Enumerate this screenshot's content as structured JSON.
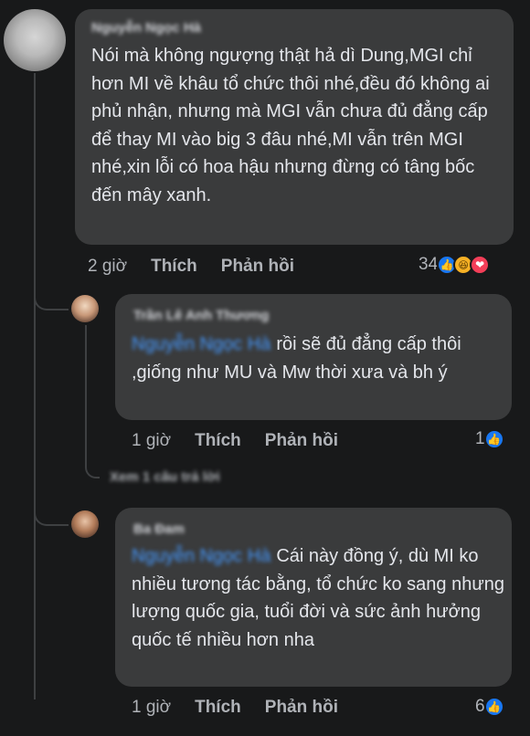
{
  "comment": {
    "author": "Nguyễn Ngọc Hà",
    "text": "Nói mà không ngượng thật hả dì Dung,MGI chỉ hơn MI về khâu tổ chức thôi nhé,đều đó không ai phủ nhận, nhưng mà MGI vẫn chưa đủ đẳng cấp để thay MI vào big 3 đâu nhé,MI vẫn trên MGI nhé,xin lỗi có hoa hậu nhưng đừng có tâng bốc đến mây xanh.",
    "time": "2 giờ",
    "like_label": "Thích",
    "reply_label": "Phản hồi",
    "reaction_count": "34",
    "reaction_icons": [
      "like-icon",
      "haha-icon",
      "love-icon"
    ]
  },
  "replies": [
    {
      "author": "Trần Lê Anh Thương",
      "mention": "Nguyễn Ngọc Hà",
      "text": "rồi sẽ đủ đẳng cấp thôi ,giống như MU và Mw thời xưa và bh ý",
      "time": "1 giờ",
      "like_label": "Thích",
      "reply_label": "Phản hồi",
      "reaction_count": "1",
      "reaction_icons": [
        "like-icon"
      ]
    },
    {
      "author": "Ba Đam",
      "mention": "Nguyễn Ngọc Hà",
      "text": "Cái này đồng ý, dù MI ko nhiều tương tác bằng, tổ chức ko sang nhưng lượng quốc gia, tuổi đời và sức ảnh hưởng quốc tế nhiều hơn nha",
      "time": "1 giờ",
      "like_label": "Thích",
      "reply_label": "Phản hồi",
      "reaction_count": "6",
      "reaction_icons": [
        "like-icon"
      ]
    }
  ],
  "more_replies_label": "Xem 1 câu trả lời",
  "colors": {
    "background": "#18191a",
    "bubble": "#3a3b3c",
    "text": "#e4e6eb",
    "secondary": "#b0b3b8",
    "mention": "#4599ff",
    "like": "#1877f2",
    "haha": "#f7b125",
    "love": "#f33e58"
  }
}
